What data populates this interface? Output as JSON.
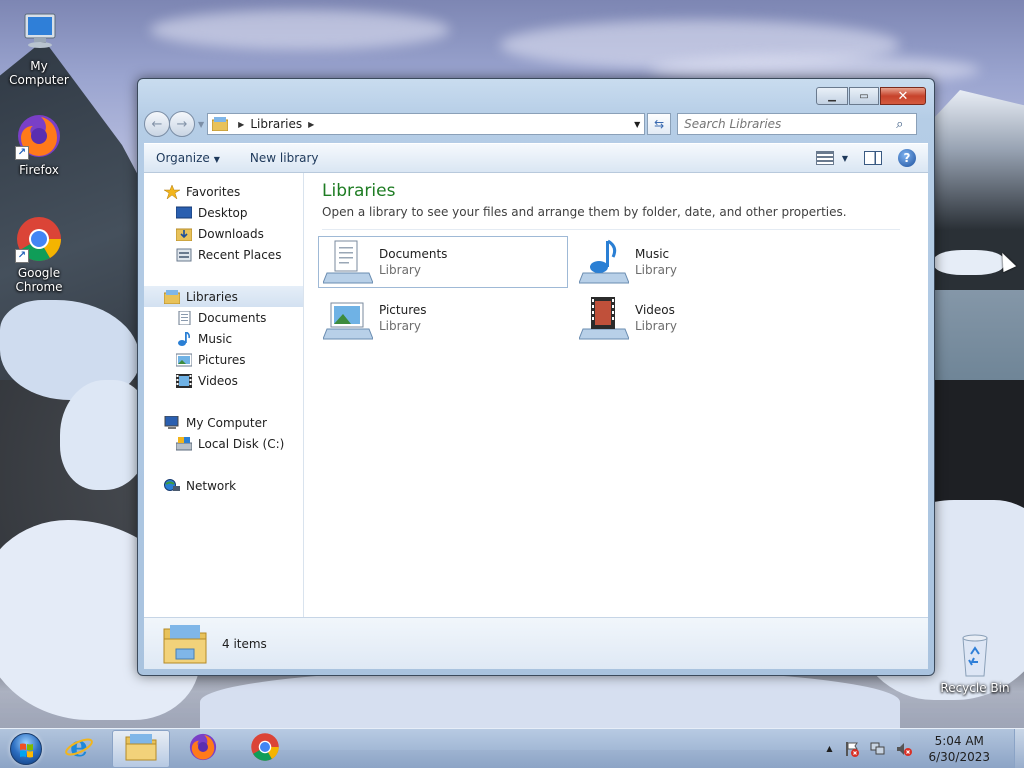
{
  "desktop": {
    "icons": [
      {
        "label": "My Computer"
      },
      {
        "label": "Firefox"
      },
      {
        "label": "Google Chrome"
      },
      {
        "label": "Recycle Bin"
      }
    ]
  },
  "window": {
    "address": {
      "segment": "Libraries"
    },
    "search": {
      "placeholder": "Search Libraries"
    },
    "command_bar": {
      "organize": "Organize",
      "new_library": "New library"
    },
    "nav_pane": {
      "favorites": "Favorites",
      "desktop": "Desktop",
      "downloads": "Downloads",
      "recent_places": "Recent Places",
      "libraries": "Libraries",
      "documents": "Documents",
      "music": "Music",
      "pictures": "Pictures",
      "videos": "Videos",
      "my_computer": "My Computer",
      "local_disk": "Local Disk (C:)",
      "network": "Network"
    },
    "content": {
      "title": "Libraries",
      "subtitle": "Open a library to see your files and arrange them by folder, date, and other properties.",
      "libraries": [
        {
          "name": "Documents",
          "type": "Library"
        },
        {
          "name": "Music",
          "type": "Library"
        },
        {
          "name": "Pictures",
          "type": "Library"
        },
        {
          "name": "Videos",
          "type": "Library"
        }
      ]
    },
    "details": {
      "count": "4 items"
    }
  },
  "taskbar": {
    "clock_time": "5:04 AM",
    "clock_date": "6/30/2023"
  },
  "colors": {
    "title_green": "#1e7c23",
    "close_red": "#c7432c",
    "selection": "#d3e1f1"
  }
}
